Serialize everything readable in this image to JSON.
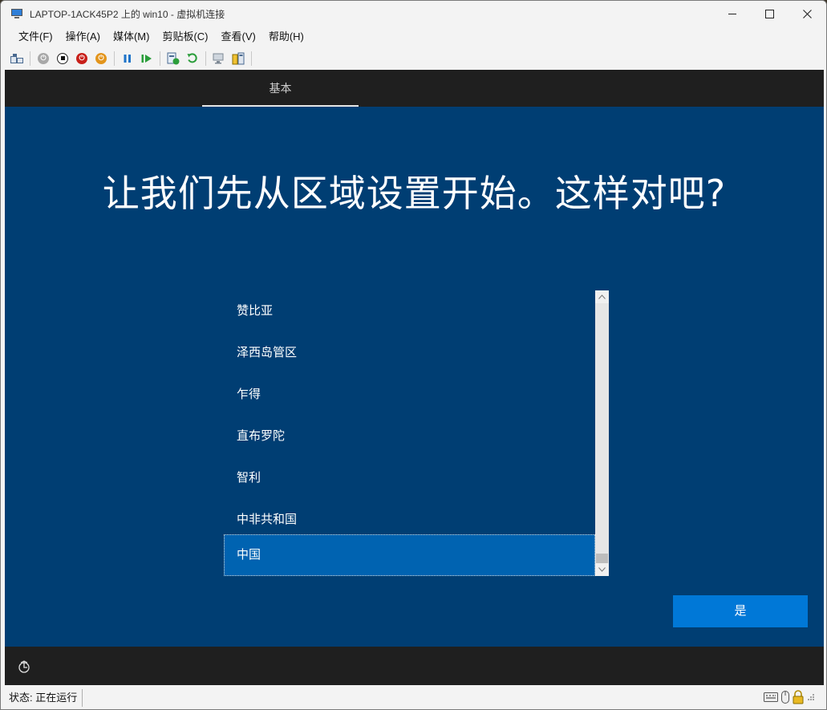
{
  "window": {
    "title": "LAPTOP-1ACK45P2 上的 win10 - 虚拟机连接",
    "controls": [
      "minimize",
      "maximize",
      "close"
    ]
  },
  "menubar": {
    "items": [
      {
        "label": "文件(F)"
      },
      {
        "label": "操作(A)"
      },
      {
        "label": "媒体(M)"
      },
      {
        "label": "剪贴板(C)"
      },
      {
        "label": "查看(V)"
      },
      {
        "label": "帮助(H)"
      }
    ]
  },
  "toolbar": {
    "icons": [
      "ctrl-alt-del-icon",
      "start-icon",
      "turn-off-icon",
      "shut-down-icon",
      "save-icon",
      "pause-icon",
      "resume-icon",
      "checkpoint-icon",
      "revert-icon",
      "enhanced-session-icon",
      "share-icon"
    ]
  },
  "oobe": {
    "tab_label": "基本",
    "headline": "让我们先从区域设置开始。这样对吧?",
    "regions": [
      {
        "label": "赞比亚"
      },
      {
        "label": "泽西岛管区"
      },
      {
        "label": "乍得"
      },
      {
        "label": "直布罗陀"
      },
      {
        "label": "智利"
      },
      {
        "label": "中非共和国"
      },
      {
        "label": "中国"
      }
    ],
    "selected_region": "中国",
    "yes_label": "是",
    "colors": {
      "background": "#003e73",
      "selected": "#0063b1",
      "button": "#0078d7",
      "bars": "#1f1f1f"
    }
  },
  "statusbar": {
    "status_text": "状态: 正在运行"
  }
}
